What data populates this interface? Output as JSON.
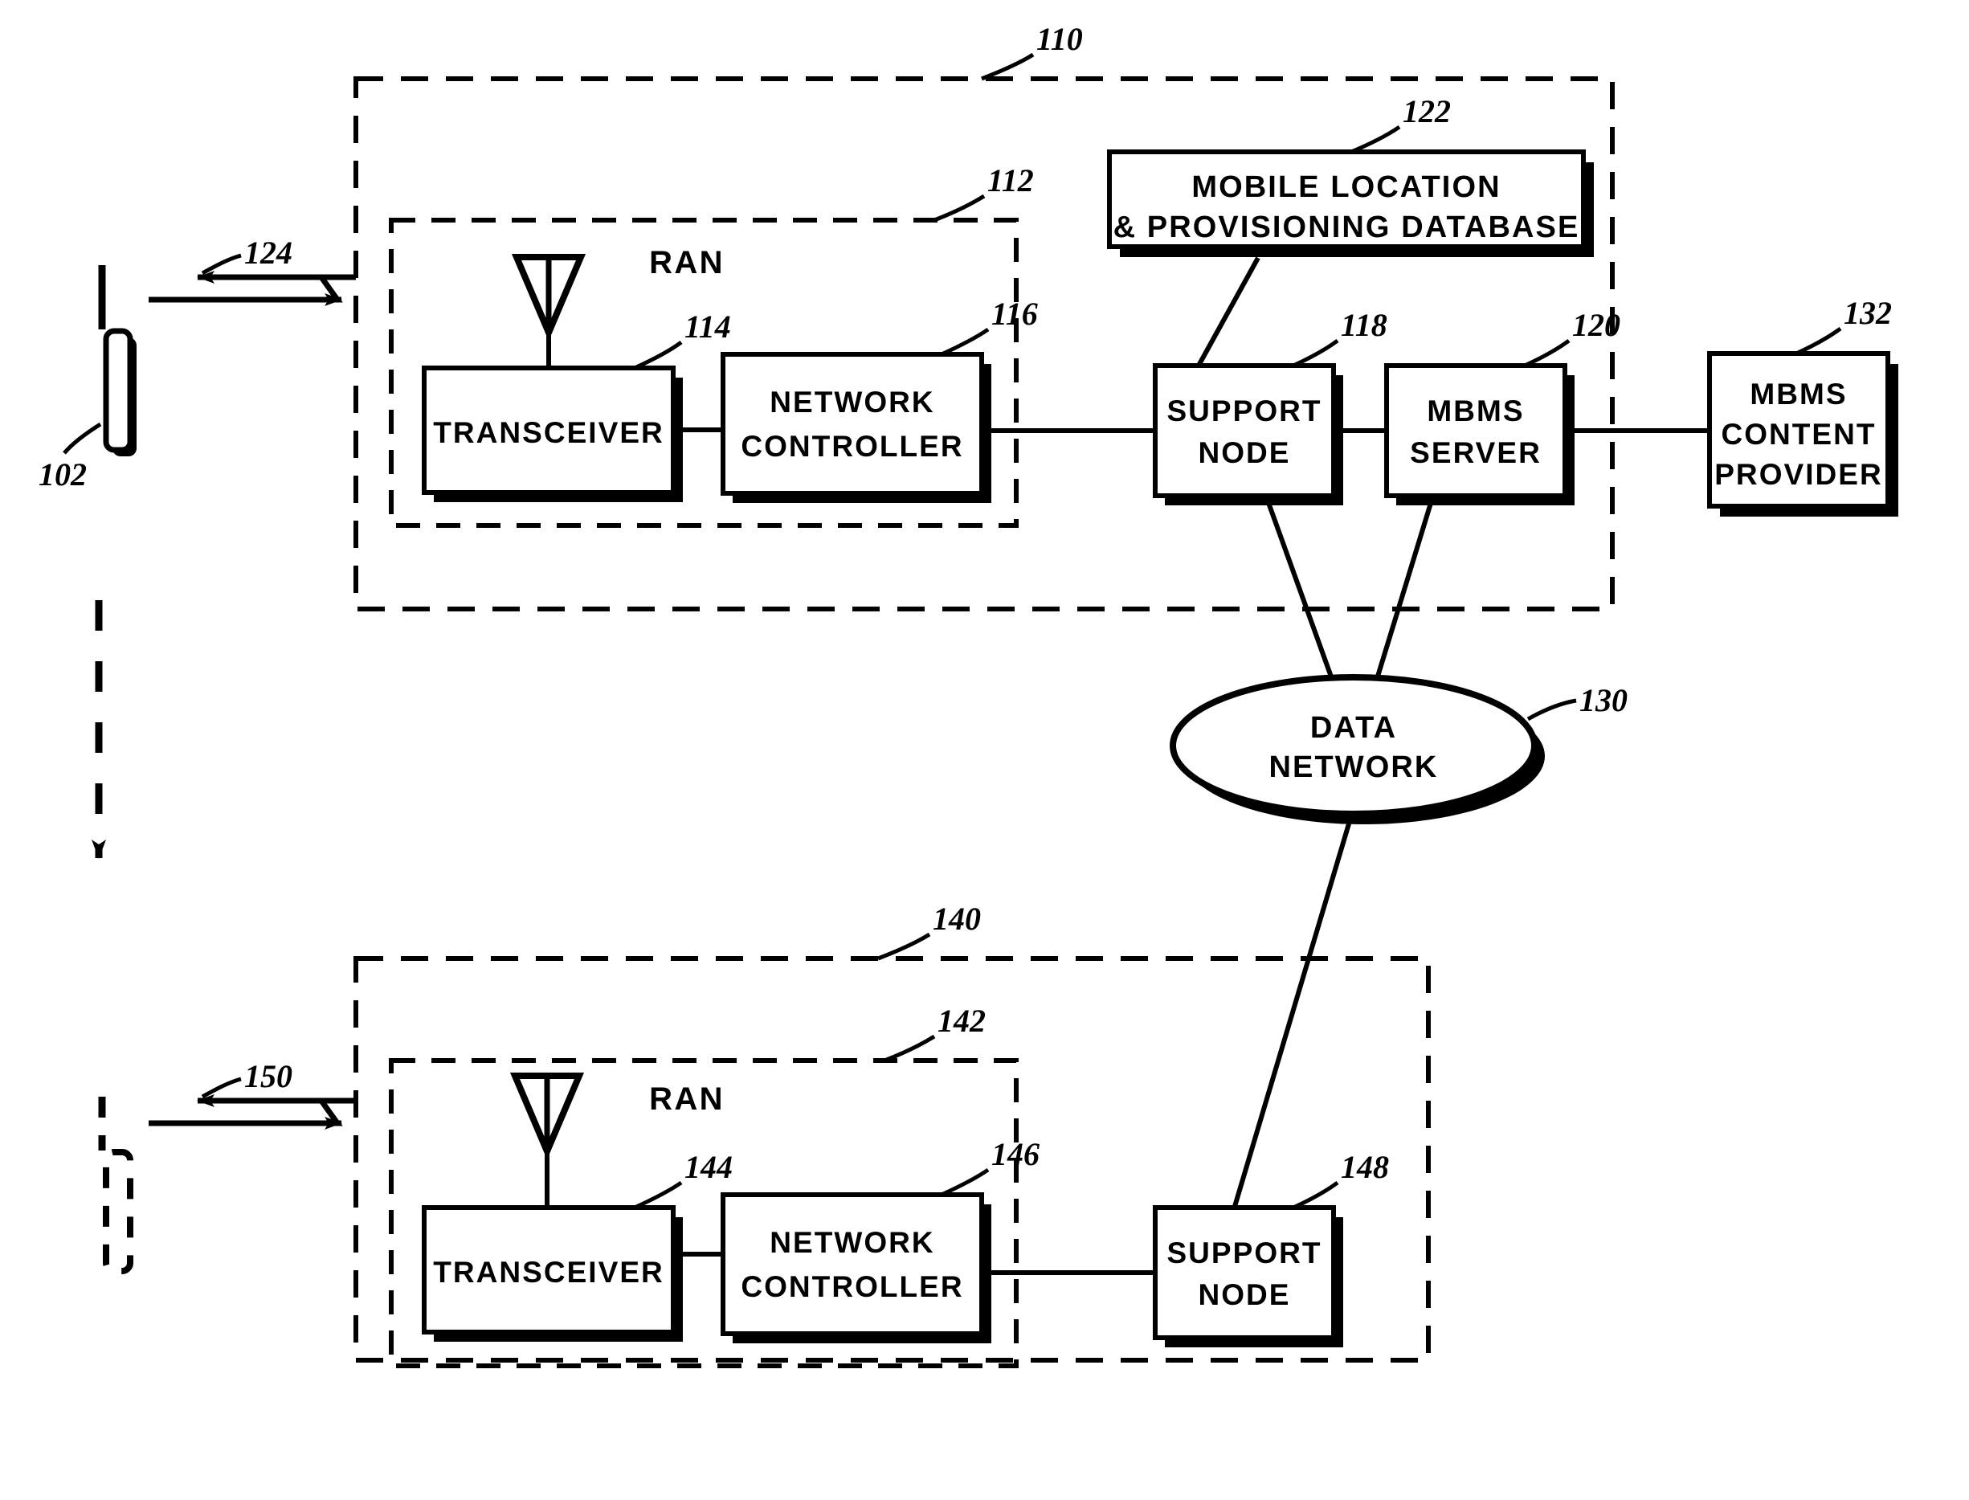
{
  "figure": {
    "title": "Wireless MBMS network architecture diagram",
    "type": "patent-block-diagram",
    "line_color": "#000000",
    "background_color": "#ffffff"
  },
  "nodes": {
    "mobile_station": {
      "ref": "102",
      "label": ""
    },
    "core_network": {
      "ref": "110",
      "label": ""
    },
    "ran_top": {
      "ref": "112",
      "label": "RAN"
    },
    "transceiver_top": {
      "ref": "114",
      "label": "TRANSCEIVER"
    },
    "network_controller_top": {
      "ref": "116",
      "line1": "NETWORK",
      "line2": "CONTROLLER"
    },
    "support_node_top": {
      "ref": "118",
      "line1": "SUPPORT",
      "line2": "NODE"
    },
    "mbms_server": {
      "ref": "120",
      "line1": "MBMS",
      "line2": "SERVER"
    },
    "mobile_location_db": {
      "ref": "122",
      "line1": "MOBILE LOCATION",
      "line2": "& PROVISIONING DATABASE"
    },
    "air_link_top": {
      "ref": "124",
      "label": ""
    },
    "data_network": {
      "ref": "130",
      "line1": "DATA",
      "line2": "NETWORK"
    },
    "mbms_content_provider": {
      "ref": "132",
      "line1": "MBMS",
      "line2": "CONTENT",
      "line3": "PROVIDER"
    },
    "core_network_bottom": {
      "ref": "140",
      "label": ""
    },
    "ran_bottom": {
      "ref": "142",
      "label": "RAN"
    },
    "transceiver_bottom": {
      "ref": "144",
      "label": "TRANSCEIVER"
    },
    "network_controller_bottom": {
      "ref": "146",
      "line1": "NETWORK",
      "line2": "CONTROLLER"
    },
    "support_node_bottom": {
      "ref": "148",
      "line1": "SUPPORT",
      "line2": "NODE"
    },
    "air_link_bottom": {
      "ref": "150",
      "label": ""
    }
  },
  "reference_numerals": [
    "102",
    "110",
    "112",
    "114",
    "116",
    "118",
    "120",
    "122",
    "124",
    "130",
    "132",
    "140",
    "142",
    "144",
    "146",
    "148",
    "150"
  ]
}
